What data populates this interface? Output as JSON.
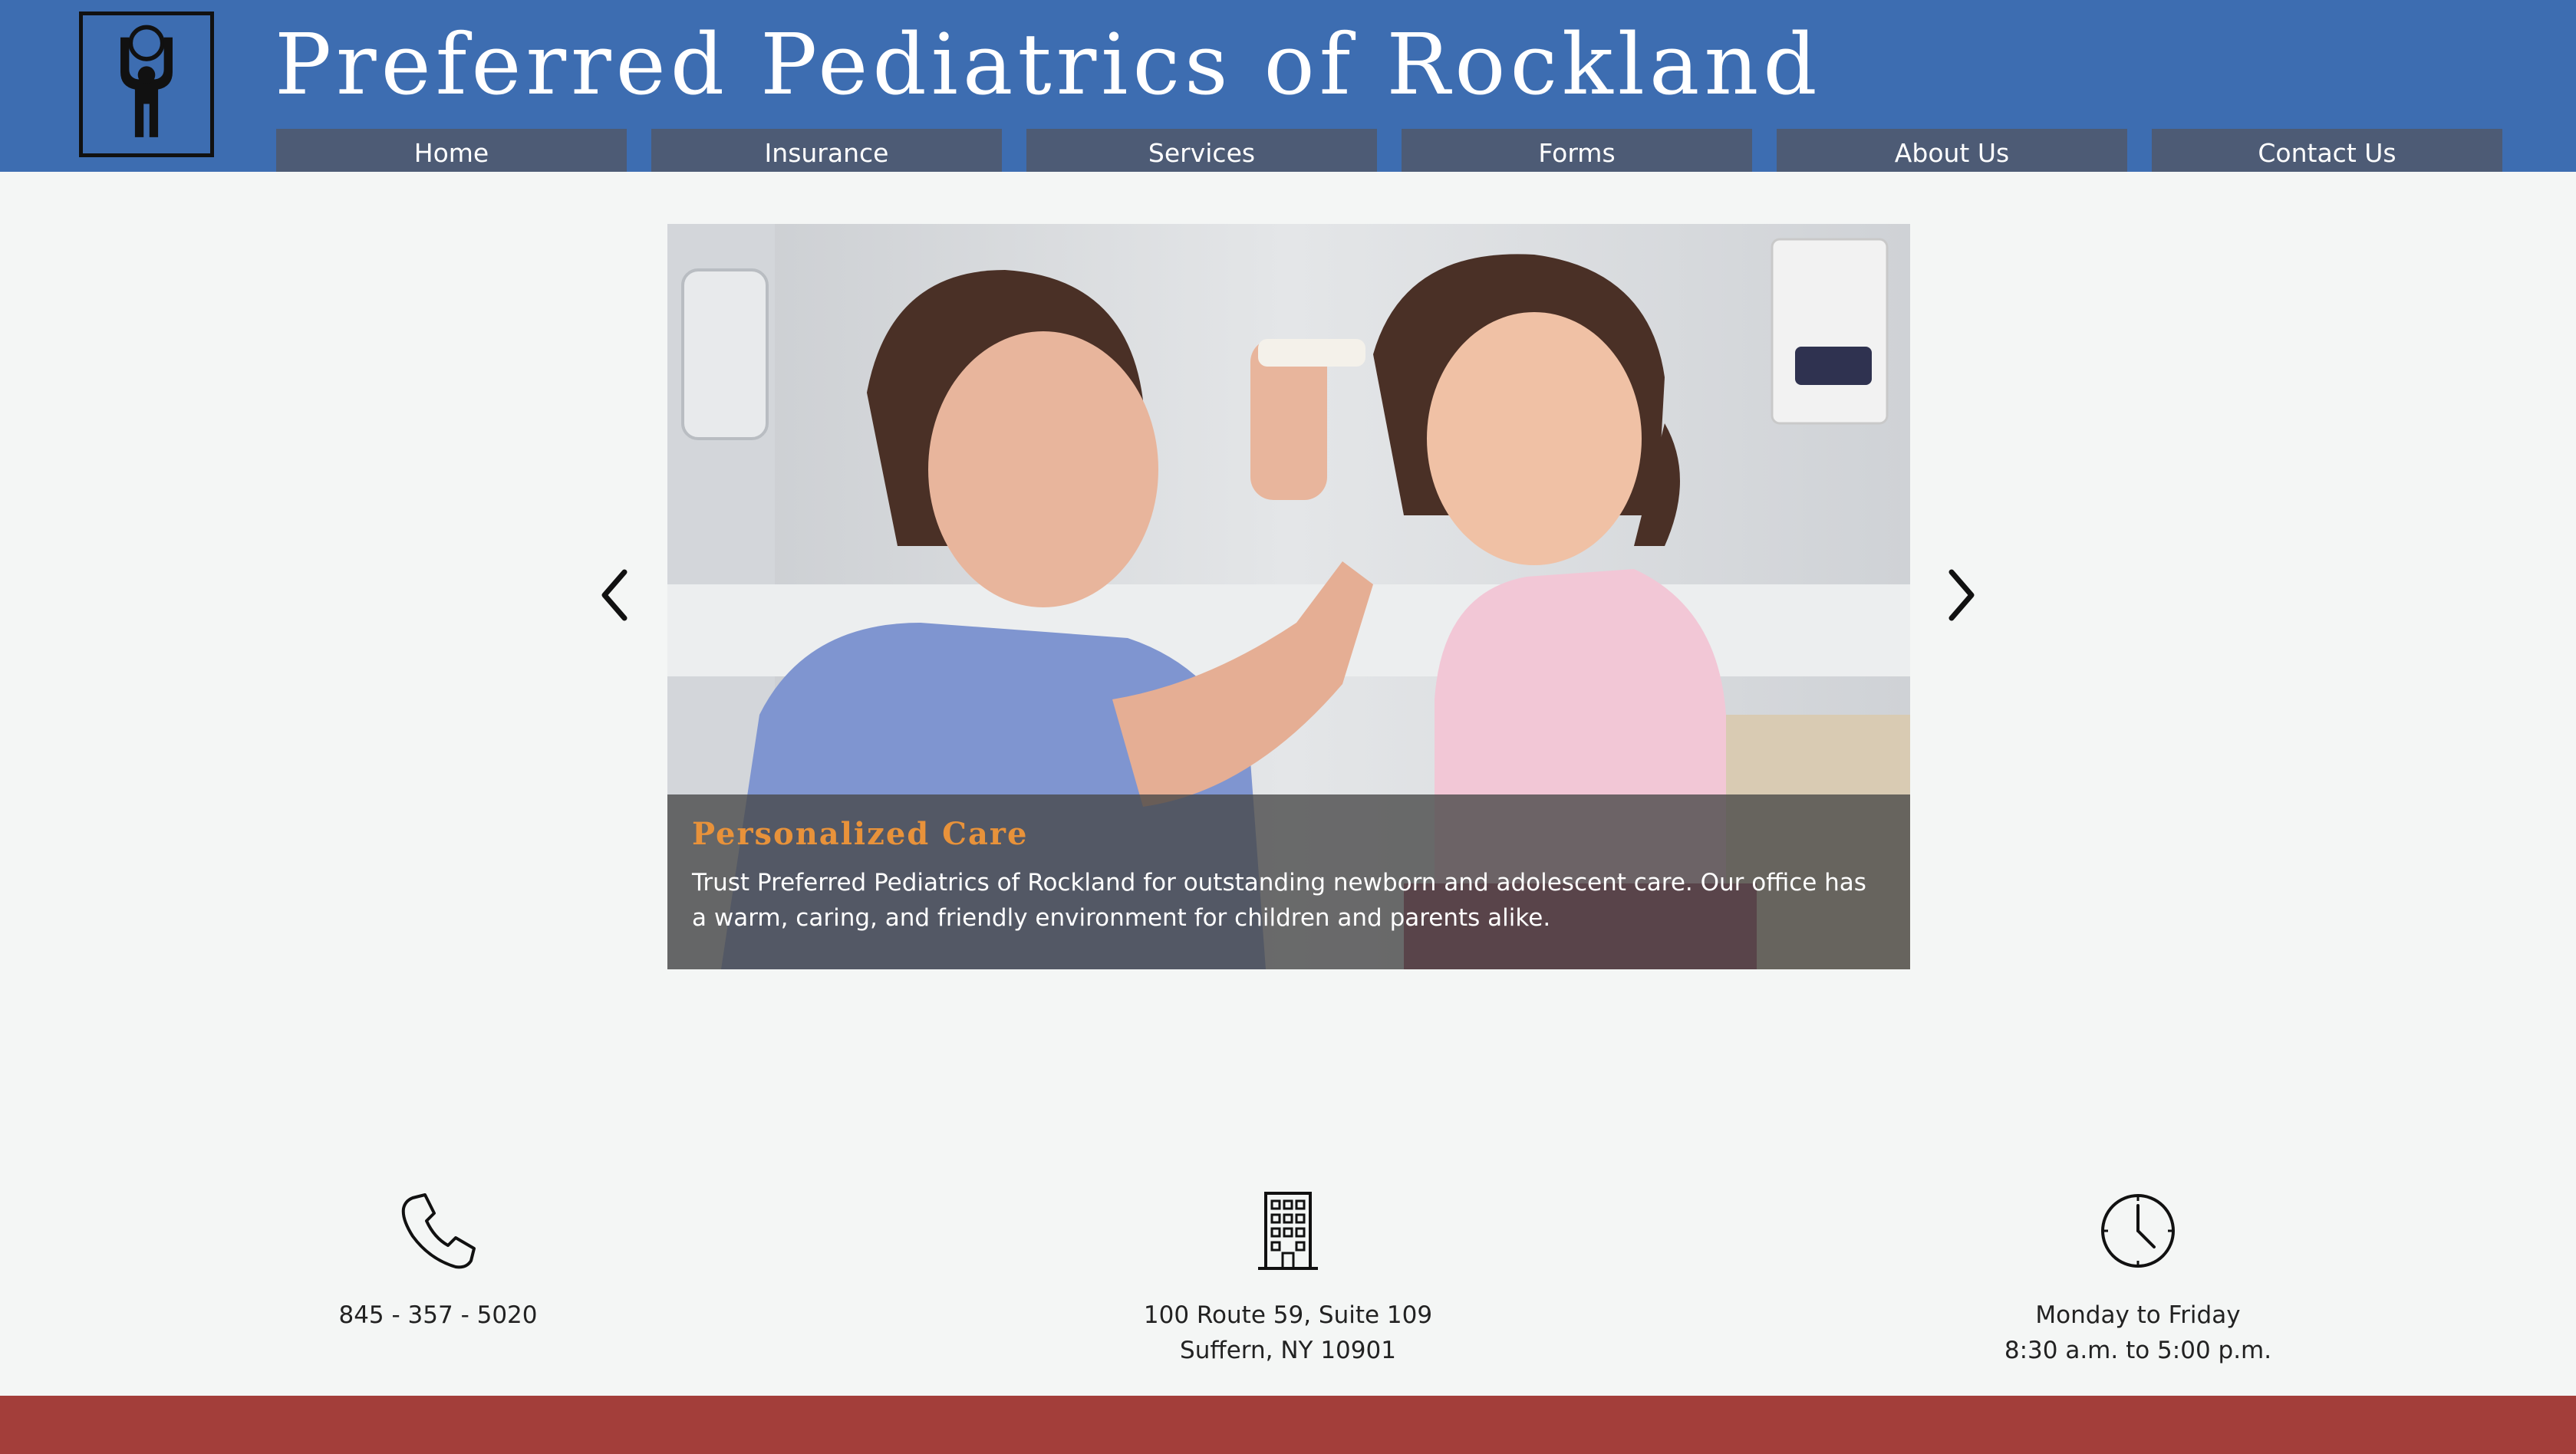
{
  "header": {
    "title": "Preferred Pediatrics of Rockland",
    "logo_icon": "child-figure-logo-icon",
    "background": "#3d6db1"
  },
  "nav": {
    "items": [
      {
        "label": "Home"
      },
      {
        "label": "Insurance"
      },
      {
        "label": "Services"
      },
      {
        "label": "Forms"
      },
      {
        "label": "About Us"
      },
      {
        "label": "Contact Us"
      }
    ],
    "background": "#4d5b75"
  },
  "slider": {
    "prev_icon": "chevron-left-icon",
    "next_icon": "chevron-right-icon",
    "slide": {
      "title": "Personalized Care",
      "text": "Trust Preferred Pediatrics of Rockland for outstanding newborn and adolescent care. Our office has a warm, caring, and friendly environment for children and parents alike.",
      "title_color": "#e8923a"
    }
  },
  "info": {
    "phone": {
      "icon": "phone-icon",
      "text": "845 - 357 - 5020"
    },
    "address": {
      "icon": "building-icon",
      "line1": "100 Route 59, Suite 109",
      "line2": "Suffern, NY 10901"
    },
    "hours": {
      "icon": "clock-icon",
      "line1": "Monday to Friday",
      "line2": "8:30 a.m. to 5:00 p.m."
    }
  },
  "footer": {
    "background": "#a33e3a"
  }
}
